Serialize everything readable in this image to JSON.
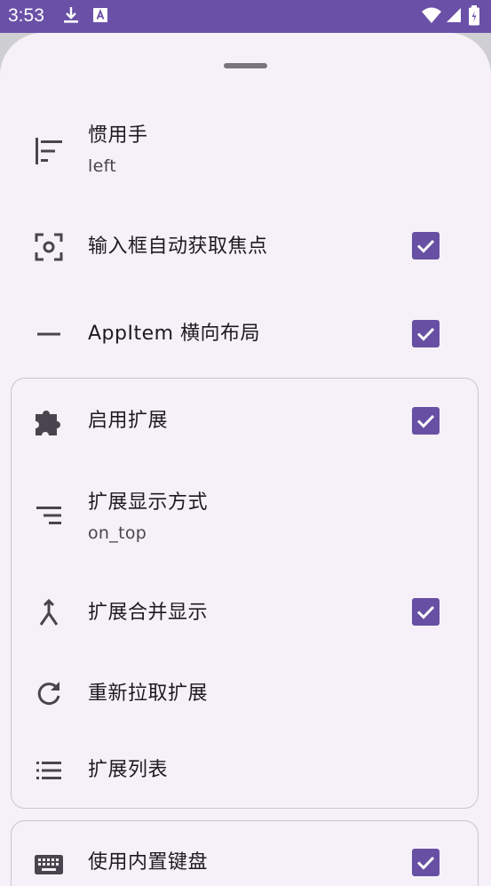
{
  "status_bar": {
    "time": "3:53"
  },
  "settings": {
    "handedness": {
      "title": "惯用手",
      "value": "left"
    },
    "autofocus": {
      "title": "输入框自动获取焦点",
      "checked": true
    },
    "appitem_horizontal": {
      "title": "AppItem 横向布局",
      "checked": true
    }
  },
  "extensions_group": {
    "enable": {
      "title": "启用扩展",
      "checked": true
    },
    "display_mode": {
      "title": "扩展显示方式",
      "value": "on_top"
    },
    "merge_display": {
      "title": "扩展合并显示",
      "checked": true
    },
    "refetch": {
      "title": "重新拉取扩展"
    },
    "list": {
      "title": "扩展列表"
    }
  },
  "keyboard_group": {
    "builtin_keyboard": {
      "title": "使用内置键盘",
      "checked": true
    }
  },
  "colors": {
    "accent": "#6750a4",
    "status_bar": "#6a50a7",
    "sheet_bg": "#f6f1f8"
  }
}
